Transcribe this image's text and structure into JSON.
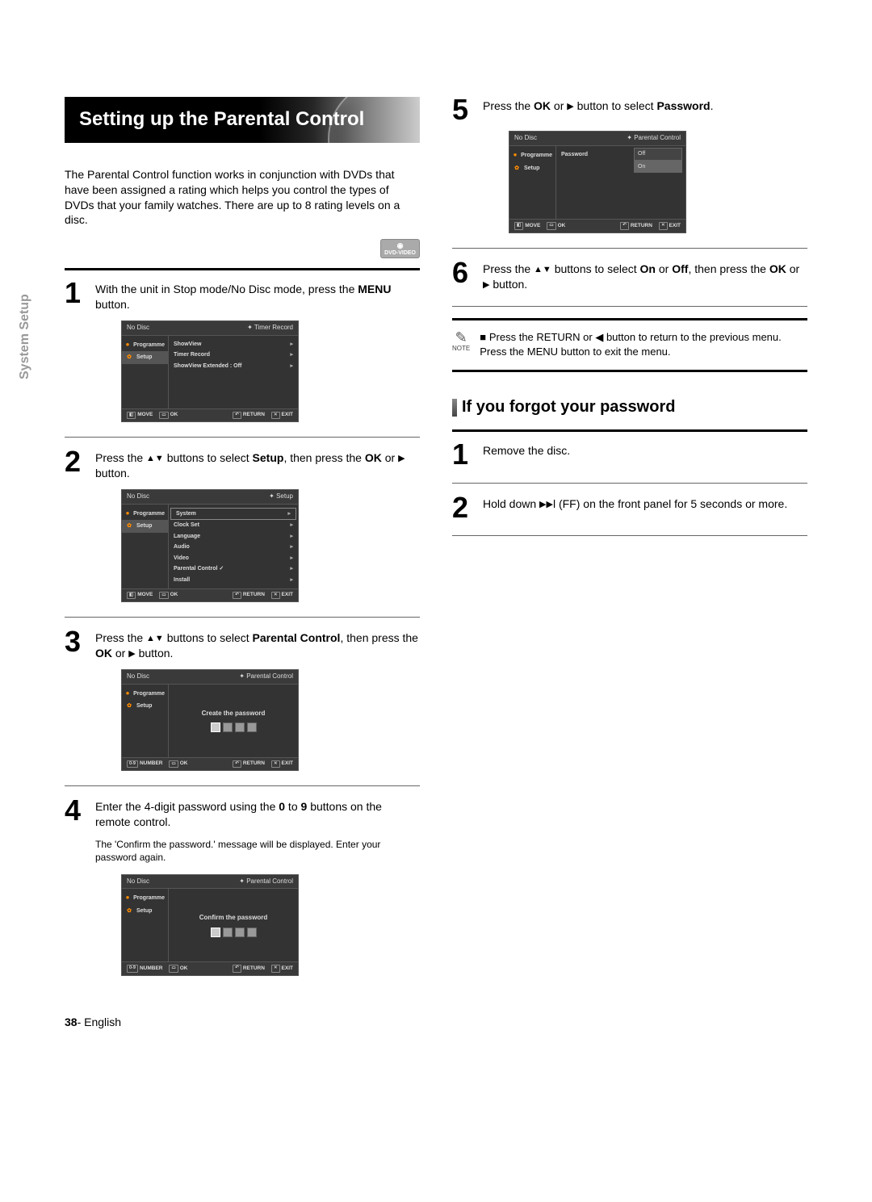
{
  "side_tab": "System Setup",
  "title": "Setting up the Parental Control",
  "intro": "The Parental Control function works in conjunction with DVDs that have been assigned a rating which helps you control the types of DVDs that your family watches. There are up to 8 rating levels on a disc.",
  "dvd_badge": "DVD-VIDEO",
  "steps_left": {
    "s1": {
      "num": "1",
      "html": "With the unit in Stop mode/No Disc mode, press the <b>MENU</b> button."
    },
    "s2": {
      "num": "2",
      "html": "Press the <span class='tri'>▲▼</span> buttons to select <b>Setup</b>, then press the <b>OK</b> or <span class='tri'>▶</span> button."
    },
    "s3": {
      "num": "3",
      "html": "Press the <span class='tri'>▲▼</span> buttons to select <b>Parental Control</b>, then press the <b>OK</b> or <span class='tri'>▶</span> button."
    },
    "s4": {
      "num": "4",
      "html": "Enter the 4-digit password using the <b>0</b> to <b>9</b> buttons on the remote control.",
      "sub": "The 'Confirm the password.' message will be displayed. Enter your password again."
    }
  },
  "steps_right": {
    "s5": {
      "num": "5",
      "html": "Press the <b>OK</b> or <span class='tri'>▶</span> button to select <b>Password</b>."
    },
    "s6": {
      "num": "6",
      "html": "Press the <span class='tri'>▲▼</span> buttons to select <b>On</b> or <b>Off</b>, then press the <b>OK</b> or <span class='tri'>▶</span> button."
    }
  },
  "note": "Press the RETURN or ◀ button to return to the previous menu. Press the MENU button to exit the menu.",
  "note_label": "NOTE",
  "subhead": "If you forgot your password",
  "forgot": {
    "f1": {
      "num": "1",
      "text": "Remove the disc."
    },
    "f2": {
      "num": "2",
      "html": "Hold down <span class='tri'>▶▶</span>l (FF) on the front panel for 5 seconds or more."
    }
  },
  "osd_common": {
    "no_disc": "No Disc",
    "side": {
      "programme": "Programme",
      "setup": "Setup"
    },
    "foot": {
      "move": "MOVE",
      "number": "NUMBER",
      "ok": "OK",
      "return": "RETURN",
      "exit": "EXIT"
    }
  },
  "osd1": {
    "crumb": "Timer Record",
    "rows": [
      "ShowView",
      "Timer Record",
      "ShowView Extended : Off"
    ]
  },
  "osd2": {
    "crumb": "Setup",
    "top": "System",
    "rows": [
      "Clock Set",
      "Language",
      "Audio",
      "Video",
      "Parental Control ✓",
      "Install"
    ]
  },
  "osd3": {
    "crumb": "Parental Control",
    "msg": "Create the password"
  },
  "osd4": {
    "crumb": "Parental Control",
    "msg": "Confirm the password"
  },
  "osd5": {
    "crumb": "Parental Control",
    "row_label": "Password",
    "opts": [
      "Off",
      "On"
    ]
  },
  "footer_page": "38",
  "footer_lang": "English"
}
